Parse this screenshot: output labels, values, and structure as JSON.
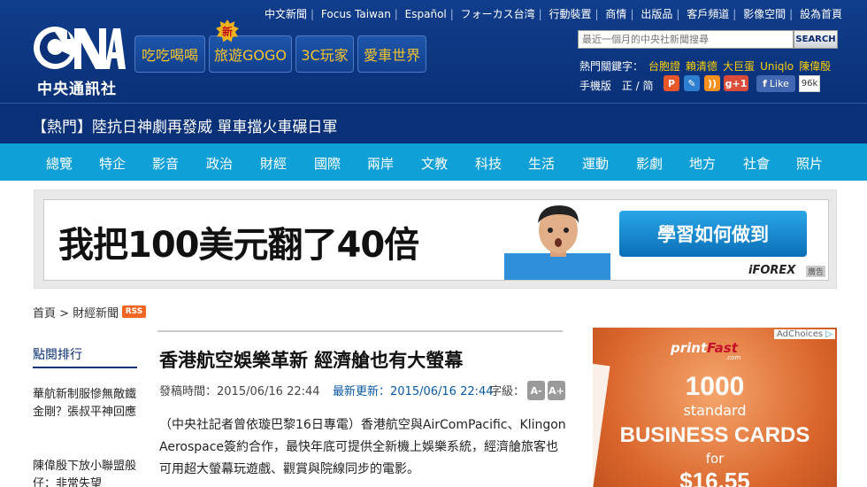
{
  "header": {
    "logo_text": "中央通訊社",
    "promos": [
      {
        "label": "吃吃喝喝"
      },
      {
        "label": "旅遊GOGO"
      },
      {
        "label": "3C玩家"
      },
      {
        "label": "愛車世界"
      }
    ],
    "new_badge": "新",
    "top_links": [
      "中文新聞",
      "Focus Taiwan",
      "Español",
      "フォーカス台湾",
      "行動裝置",
      "商情",
      "出版品",
      "客戶頻道",
      "影像空間",
      "設為首頁"
    ],
    "search": {
      "placeholder": "最近一個月的中央社新聞搜尋",
      "button": "SEARCH"
    },
    "hot_keywords_label": "熱門關鍵字：",
    "hot_keywords": [
      "台胞證",
      "賴清德",
      "大巨蛋",
      "Uniqlo",
      "陳偉殷"
    ],
    "mobile_label": "手機版",
    "trad_simp": "正 / 简",
    "social": {
      "gplus": "g+1",
      "fb_like": "Like",
      "fb_count": "96k"
    },
    "colors": {
      "header_bg": "#0a3178",
      "accent_yellow": "#f6c52a",
      "nav_bg": "#10a0d8"
    }
  },
  "hotbar": {
    "text": "【熱門】陸抗日神劇再發威 單車擋火車碾日軍"
  },
  "nav": [
    "總覽",
    "特企",
    "影音",
    "政治",
    "財經",
    "國際",
    "兩岸",
    "文教",
    "科技",
    "生活",
    "運動",
    "影劇",
    "地方",
    "社會",
    "照片"
  ],
  "banner_ad": {
    "headline": "我把100美元翻了40倍",
    "cta": "學習如何做到",
    "brand": "iFOREX",
    "tag": "廣告"
  },
  "breadcrumb": {
    "text": "首頁 > 財經新聞",
    "rss": "RSS"
  },
  "sidebar": {
    "title": "點閱排行",
    "items": [
      "華航新制服慘無敵鐵金剛？張叔平神回應",
      "陳偉殷下放小聯盟般仔：非常失望"
    ]
  },
  "article": {
    "title": "香港航空娛樂革新 經濟艙也有大螢幕",
    "published_label": "發稿時間：",
    "published": "2015/06/16 22:44",
    "updated_label": "最新更新：",
    "updated": "2015/06/16 22:44",
    "font_label": "字級：",
    "font_smaller": "A-",
    "font_larger": "A+",
    "body": "（中央社記者曾依璇巴黎16日專電）香港航空與AirComPacific、Klingon Aerospace簽約合作，最快年底可提供全新機上娛樂系統，經濟艙旅客也可用超大螢幕玩遊戲、觀賞與院線同步的電影。"
  },
  "right_ad": {
    "adchoices": "AdChoices",
    "logo_print": "print",
    "logo_fast": "Fast",
    "logo_sub": ".com",
    "line1": "1000",
    "line2": "standard",
    "line3": "BUSINESS CARDS",
    "line4": "for",
    "line5": "$16.55"
  }
}
